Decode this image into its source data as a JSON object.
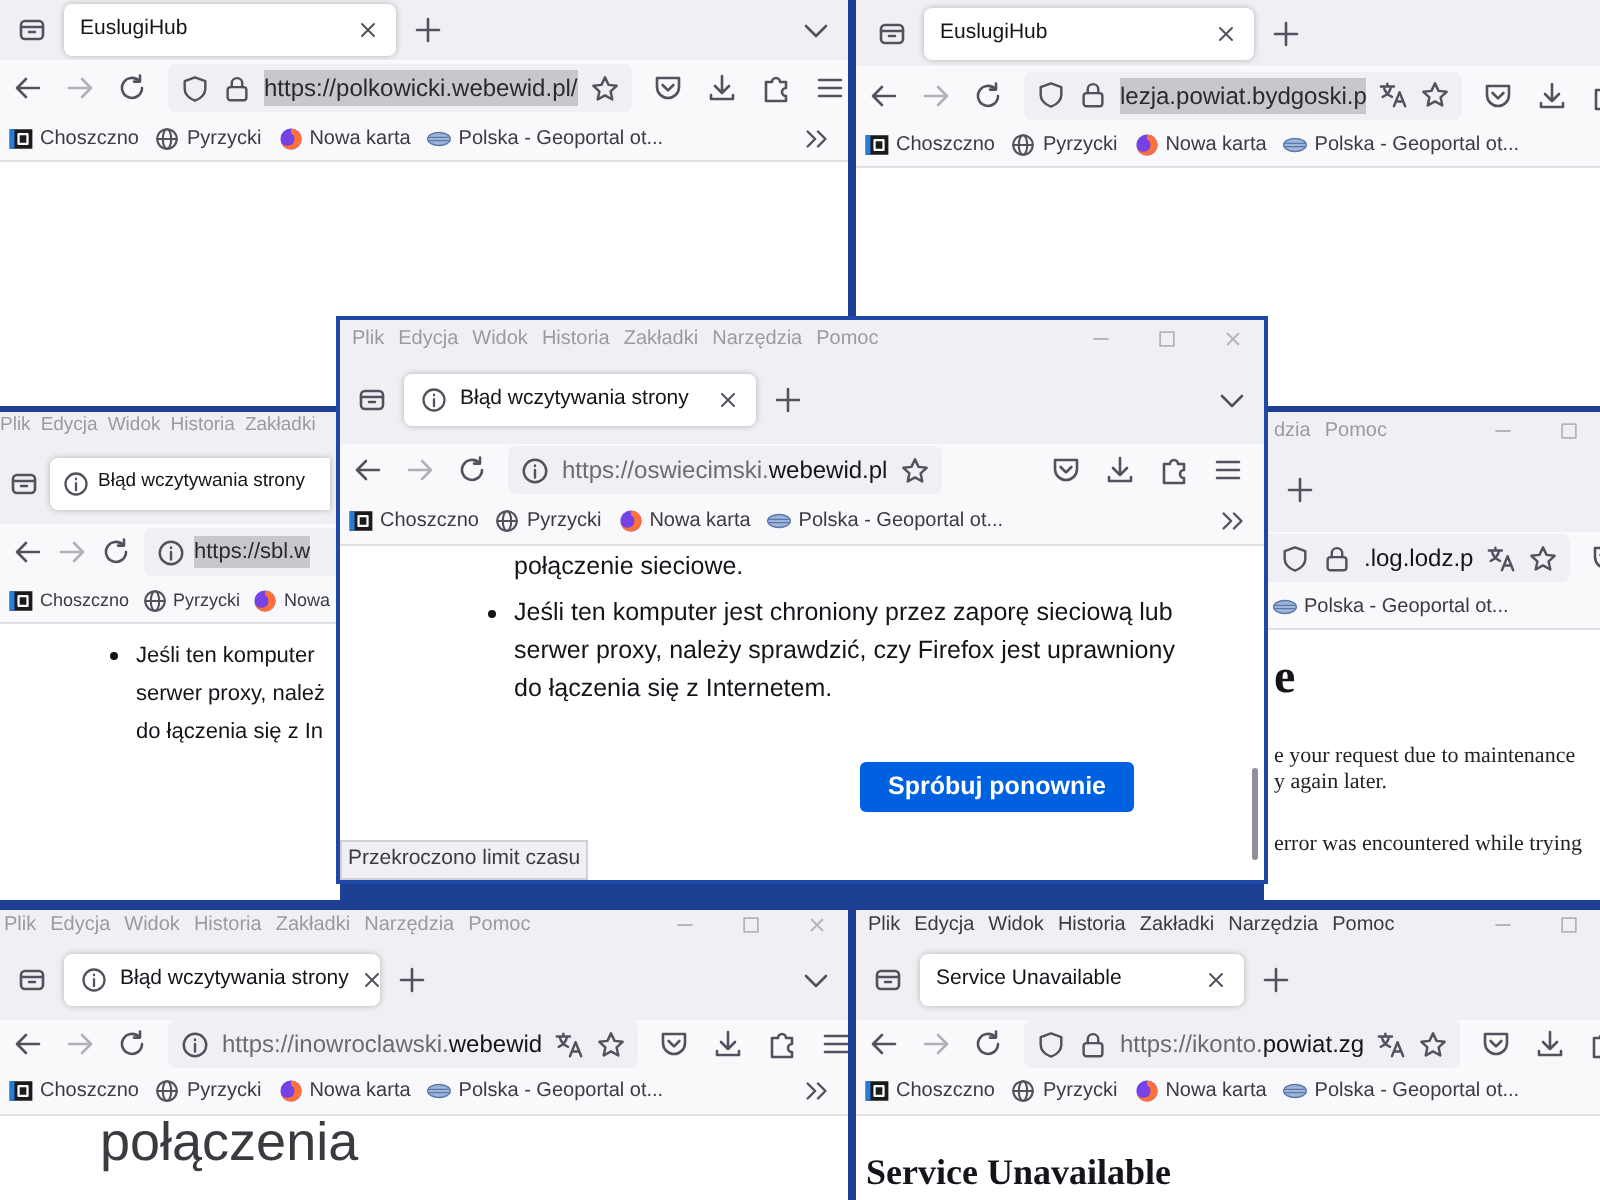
{
  "windows": [
    {
      "kind": "full",
      "tab": {
        "title": "EuslugiHub",
        "has_info_icon": false
      },
      "url": {
        "text": "https://polkowicki.webewid.pl/",
        "selected": true,
        "secure": true
      },
      "bookmarks": [
        {
          "kind": "gi",
          "label": "Choszczno"
        },
        {
          "kind": "globe",
          "label": "Pyrzycki"
        },
        {
          "kind": "fox",
          "label": "Nowa karta"
        },
        {
          "kind": "geo",
          "label": "Polska - Geoportal ot..."
        }
      ]
    },
    {
      "kind": "full",
      "tab": {
        "title": "EuslugiHub",
        "has_info_icon": false
      },
      "url": {
        "text": "lezja.powiat.bydgoski.p",
        "selected": true,
        "secure": true
      },
      "bookmarks": [
        {
          "kind": "gi",
          "label": "Choszczno"
        },
        {
          "kind": "globe",
          "label": "Pyrzycki"
        },
        {
          "kind": "fox",
          "label": "Nowa karta"
        },
        {
          "kind": "geo",
          "label": "Polska - Geoportal ot..."
        }
      ]
    },
    {
      "kind": "clipped-right",
      "focused": false,
      "menu": [
        "Plik",
        "Edycja",
        "Widok",
        "Historia",
        "Zakładki"
      ],
      "tab": {
        "title": "Błąd wczytywania strony",
        "has_info_icon": true
      },
      "url": {
        "text": "https://sbl.w",
        "selected": true,
        "secure": false
      },
      "bookmarks": [
        {
          "kind": "gi",
          "label": "Choszczno"
        },
        {
          "kind": "globe",
          "label": "Pyrzycki"
        },
        {
          "kind": "fox",
          "label": "Nowa"
        }
      ],
      "content": [
        {
          "kind": "bullet",
          "lines": [
            "Jeśli ten komputer",
            "serwer proxy, należ",
            "do łączenia się z In"
          ]
        }
      ]
    },
    {
      "kind": "full",
      "focused": false,
      "menu": [
        "Plik",
        "Edycja",
        "Widok",
        "Historia",
        "Zakładki",
        "Narzędzia",
        "Pomoc"
      ],
      "tab": {
        "title": "Błąd wczytywania strony",
        "has_info_icon": true
      },
      "url": {
        "prefix": "https://oswiecimski.",
        "domain": "webewid.pl",
        "secure": false
      },
      "bookmarks": [
        {
          "kind": "gi",
          "label": "Choszczno"
        },
        {
          "kind": "globe",
          "label": "Pyrzycki"
        },
        {
          "kind": "fox",
          "label": "Nowa karta"
        },
        {
          "kind": "geo",
          "label": "Polska - Geoportal ot..."
        }
      ],
      "content": [
        {
          "kind": "text",
          "text": "połączenie sieciowe."
        },
        {
          "kind": "bullet",
          "lines": [
            "Jeśli ten komputer jest chroniony przez zaporę sieciową lub",
            "serwer proxy, należy sprawdzić, czy Firefox jest uprawniony",
            "do łączenia się z Internetem."
          ]
        },
        {
          "kind": "button",
          "text": "Spróbuj ponownie"
        },
        {
          "kind": "status",
          "text": "Przekroczono limit czasu"
        }
      ]
    },
    {
      "kind": "clipped-left",
      "focused": false,
      "menu": [
        "dzia",
        "Pomoc"
      ],
      "url": {
        "text": ".log.lodz.p",
        "selected": false,
        "secure": true
      },
      "bookmarks": [
        {
          "kind": "geo",
          "label": "Polska - Geoportal ot..."
        }
      ],
      "content": [
        {
          "kind": "heading",
          "text": "e"
        },
        {
          "kind": "para",
          "lines": [
            "e your request due to maintenance",
            "y again later."
          ]
        },
        {
          "kind": "para",
          "lines": [
            "error was encountered while trying"
          ]
        }
      ]
    },
    {
      "kind": "full",
      "focused": false,
      "menu": [
        "Plik",
        "Edycja",
        "Widok",
        "Historia",
        "Zakładki",
        "Narzędzia",
        "Pomoc"
      ],
      "tab": {
        "title": "Błąd wczytywania strony",
        "has_info_icon": true
      },
      "url": {
        "prefix": "https://inowroclawski.",
        "domain": "webewid",
        "secure": false
      },
      "bookmarks": [
        {
          "kind": "gi",
          "label": "Choszczno"
        },
        {
          "kind": "globe",
          "label": "Pyrzycki"
        },
        {
          "kind": "fox",
          "label": "Nowa karta"
        },
        {
          "kind": "geo",
          "label": "Polska - Geoportal ot..."
        }
      ],
      "content": [
        {
          "kind": "light-heading",
          "text": "połączenia"
        }
      ]
    },
    {
      "kind": "full",
      "focused": true,
      "menu": [
        "Plik",
        "Edycja",
        "Widok",
        "Historia",
        "Zakładki",
        "Narzędzia",
        "Pomoc"
      ],
      "tab": {
        "title": "Service Unavailable",
        "has_info_icon": false
      },
      "url": {
        "prefix": "https://ikonto.",
        "domain": "powiat.zg",
        "secure": true
      },
      "bookmarks": [
        {
          "kind": "gi",
          "label": "Choszczno"
        },
        {
          "kind": "globe",
          "label": "Pyrzycki"
        },
        {
          "kind": "fox",
          "label": "Nowa karta"
        },
        {
          "kind": "geo",
          "label": "Polska - Geoportal ot..."
        }
      ],
      "content": [
        {
          "kind": "heading",
          "text": "Service Unavailable"
        }
      ]
    }
  ]
}
